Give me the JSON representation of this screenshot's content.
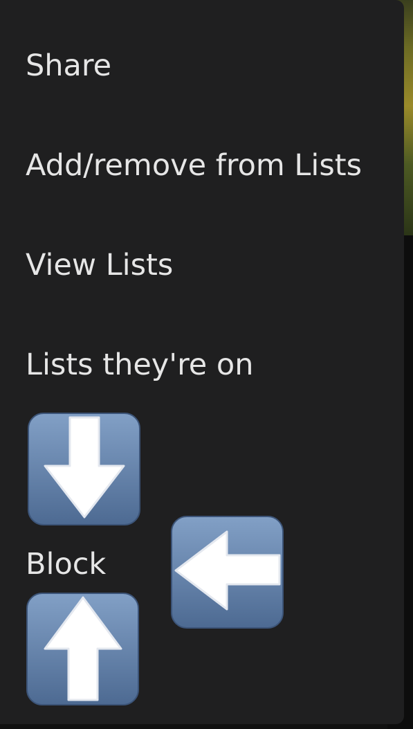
{
  "menu": {
    "items": [
      {
        "label": "Share"
      },
      {
        "label": "Add/remove from Lists"
      },
      {
        "label": "View Lists"
      },
      {
        "label": "Lists they're on"
      },
      {
        "label": "Block"
      }
    ]
  },
  "overlay_icons": [
    "arrow-down-key-icon",
    "arrow-left-key-icon",
    "arrow-up-key-icon"
  ],
  "colors": {
    "menu_background": "#1f1f20",
    "menu_text": "#e6e6e6",
    "key_blue_top": "#7e9ac0",
    "key_blue_bottom": "#4f6d96"
  }
}
